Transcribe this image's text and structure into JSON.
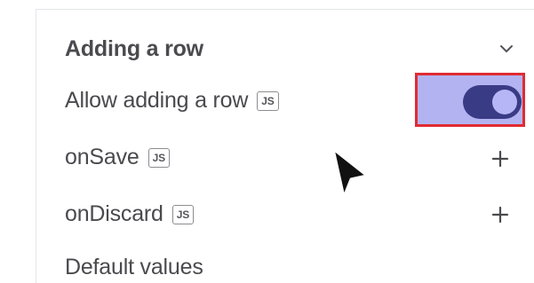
{
  "section": {
    "title": "Adding a row",
    "chevron_icon": "chevron-down-icon"
  },
  "rows": {
    "allow_adding": {
      "label": "Allow adding a row",
      "badge": "JS",
      "toggle_state": "on"
    },
    "on_save": {
      "label": "onSave",
      "badge": "JS",
      "action_icon": "plus-icon"
    },
    "on_discard": {
      "label": "onDiscard",
      "badge": "JS",
      "action_icon": "plus-icon"
    },
    "default_values": {
      "label": "Default values"
    }
  },
  "colors": {
    "toggle_on": "#3a3b85",
    "toggle_knob": "#b6b6f6",
    "highlight_fill": "#b3b3f2",
    "highlight_border": "#e12b31",
    "text": "#4a4a4e"
  }
}
